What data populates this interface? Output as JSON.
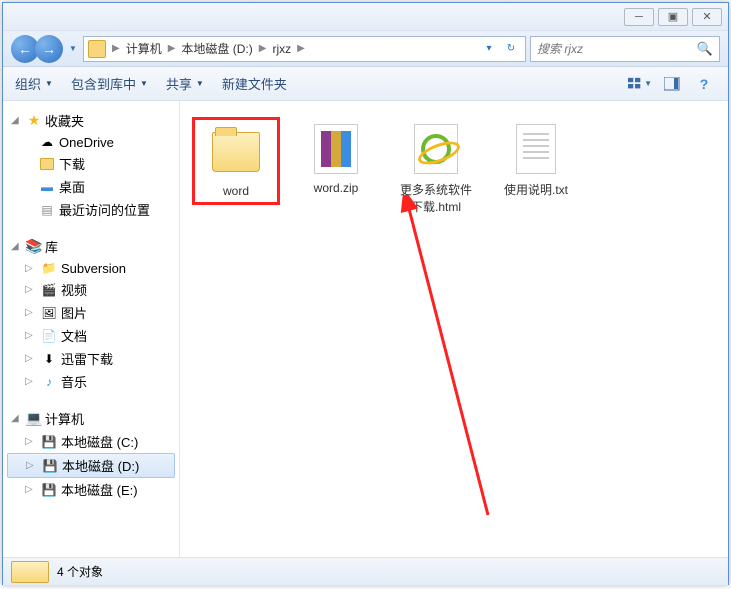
{
  "breadcrumb": {
    "segments": [
      "计算机",
      "本地磁盘 (D:)",
      "rjxz"
    ]
  },
  "search": {
    "placeholder": "搜索 rjxz"
  },
  "toolbar": {
    "organize": "组织",
    "include": "包含到库中",
    "share": "共享",
    "newfolder": "新建文件夹"
  },
  "sidebar": {
    "favorites": {
      "label": "收藏夹",
      "items": [
        {
          "icon": "cloud",
          "label": "OneDrive"
        },
        {
          "icon": "download",
          "label": "下载"
        },
        {
          "icon": "desktop",
          "label": "桌面"
        },
        {
          "icon": "recent",
          "label": "最近访问的位置"
        }
      ]
    },
    "libraries": {
      "label": "库",
      "items": [
        {
          "icon": "svn",
          "label": "Subversion"
        },
        {
          "icon": "video",
          "label": "视频"
        },
        {
          "icon": "pictures",
          "label": "图片"
        },
        {
          "icon": "documents",
          "label": "文档"
        },
        {
          "icon": "thunder",
          "label": "迅雷下载"
        },
        {
          "icon": "music",
          "label": "音乐"
        }
      ]
    },
    "computer": {
      "label": "计算机",
      "items": [
        {
          "icon": "drive",
          "label": "本地磁盘 (C:)"
        },
        {
          "icon": "drive",
          "label": "本地磁盘 (D:)",
          "selected": true
        },
        {
          "icon": "drive",
          "label": "本地磁盘 (E:)"
        }
      ]
    }
  },
  "files": [
    {
      "type": "folder",
      "name": "word",
      "highlighted": true
    },
    {
      "type": "zip",
      "name": "word.zip"
    },
    {
      "type": "html",
      "name": "更多系统软件下载.html"
    },
    {
      "type": "txt",
      "name": "使用说明.txt"
    }
  ],
  "statusbar": {
    "count": "4 个对象"
  }
}
